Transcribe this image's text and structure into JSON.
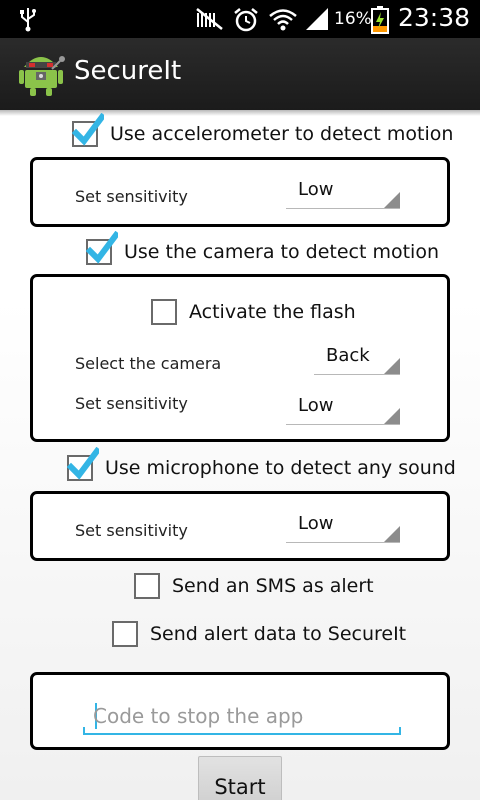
{
  "status_bar": {
    "battery_percent": "16%",
    "time": "23:38"
  },
  "app": {
    "title": "SecureIt"
  },
  "accelerometer": {
    "checkbox_label": "Use accelerometer to detect motion",
    "checked": true,
    "sensitivity_label": "Set sensitivity",
    "sensitivity_value": "Low"
  },
  "camera": {
    "checkbox_label": "Use the camera to detect motion",
    "checked": true,
    "flash_label": "Activate the flash",
    "flash_checked": false,
    "select_camera_label": "Select the camera",
    "select_camera_value": "Back",
    "sensitivity_label": "Set sensitivity",
    "sensitivity_value": "Low"
  },
  "microphone": {
    "checkbox_label": "Use microphone to detect any sound",
    "checked": true,
    "sensitivity_label": "Set sensitivity",
    "sensitivity_value": "Low"
  },
  "sms": {
    "checkbox_label": "Send an SMS as alert",
    "checked": false
  },
  "secureit_alert": {
    "checkbox_label": "Send alert data to SecureIt",
    "checked": false
  },
  "stop_code": {
    "placeholder": "Code to stop the app",
    "value": ""
  },
  "start_button": {
    "label": "Start"
  },
  "colors": {
    "accent": "#33b5e5",
    "action_bar": "#222222",
    "status_bar": "#000000"
  },
  "icons": [
    "usb-icon",
    "mute-icon",
    "alarm-icon",
    "wifi-icon",
    "signal-icon",
    "battery-charging-icon",
    "app-logo-icon",
    "checkmark-icon",
    "spinner-arrow-icon"
  ]
}
